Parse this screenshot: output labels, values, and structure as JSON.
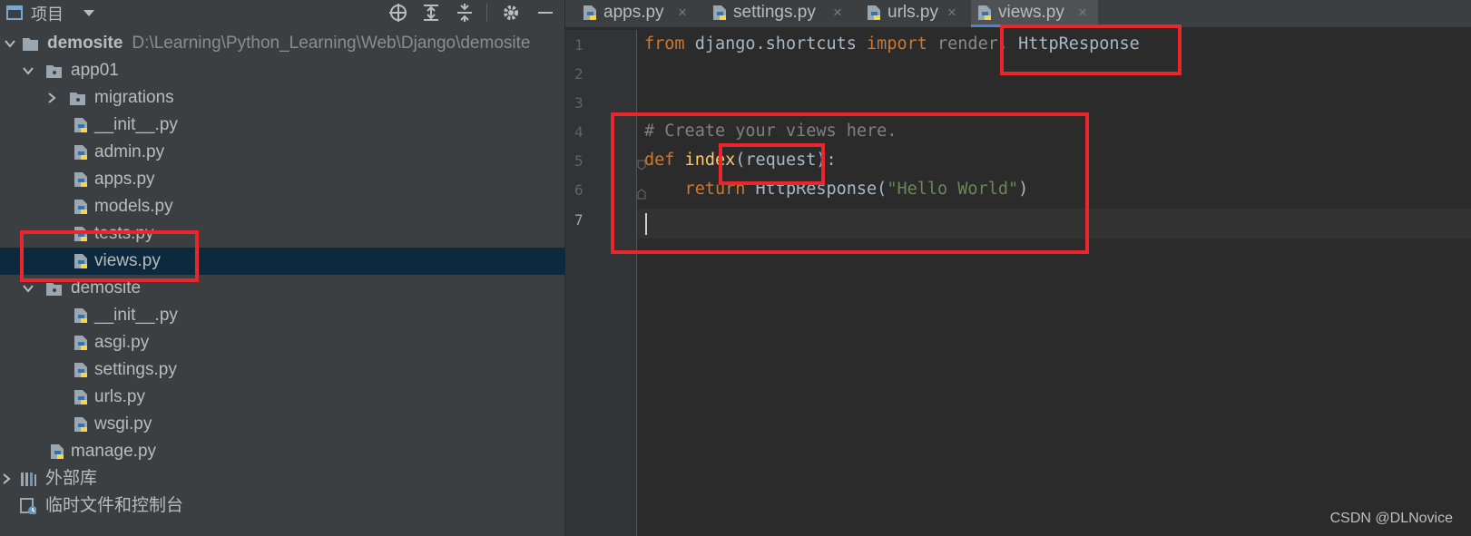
{
  "panel": {
    "title": "项目",
    "tree": [
      {
        "label": "demosite",
        "path": "D:\\Learning\\Python_Learning\\Web\\Django\\demosite"
      },
      {
        "label": "app01"
      },
      {
        "label": "migrations"
      },
      {
        "label": "__init__.py"
      },
      {
        "label": "admin.py"
      },
      {
        "label": "apps.py"
      },
      {
        "label": "models.py"
      },
      {
        "label": "tests.py"
      },
      {
        "label": "views.py"
      },
      {
        "label": "demosite"
      },
      {
        "label": "__init__.py"
      },
      {
        "label": "asgi.py"
      },
      {
        "label": "settings.py"
      },
      {
        "label": "urls.py"
      },
      {
        "label": "wsgi.py"
      },
      {
        "label": "manage.py"
      },
      {
        "label": "外部库"
      },
      {
        "label": "临时文件和控制台"
      }
    ]
  },
  "tabs": [
    {
      "label": "apps.py"
    },
    {
      "label": "settings.py"
    },
    {
      "label": "urls.py"
    },
    {
      "label": "views.py",
      "active": true
    }
  ],
  "tab_close_glyph": "×",
  "editor": {
    "line_numbers": [
      "1",
      "2",
      "3",
      "4",
      "5",
      "6",
      "7"
    ],
    "code": {
      "l1_from": "from",
      "l1_module": " django.shortcuts ",
      "l1_import": "import",
      "l1_render": " render,",
      "l1_httpresponse": " HttpResponse",
      "l4_comment": "# Create your views here.",
      "l5_def": "def",
      "l5_name": " index",
      "l5_params": "(request):",
      "l6_return": "    return",
      "l6_call": " HttpResponse(",
      "l6_string": "\"Hello World\"",
      "l6_close": ")"
    }
  },
  "watermark": "CSDN @DLNovice",
  "colors": {
    "highlight": "#e8262b",
    "selection": "#0d293e",
    "keyword": "#cc7832",
    "function": "#ffc66d",
    "string": "#6a8759",
    "comment": "#808080"
  }
}
